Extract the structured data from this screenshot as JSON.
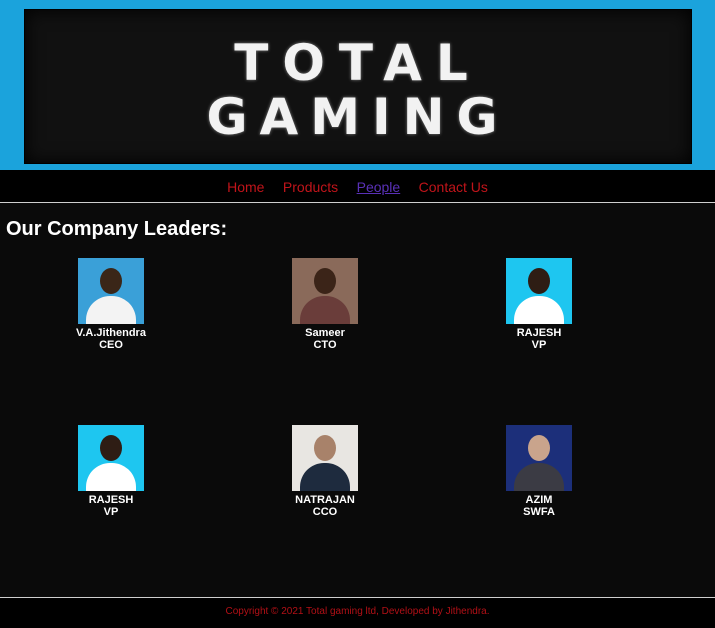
{
  "banner": {
    "line1": "TOTAL",
    "line2": "GAMING"
  },
  "nav": {
    "items": [
      {
        "label": "Home"
      },
      {
        "label": "Products"
      },
      {
        "label": "People"
      },
      {
        "label": "Contact Us"
      }
    ],
    "active": "People"
  },
  "main": {
    "title": "Our Company Leaders:"
  },
  "leaders": [
    {
      "name": "V.A.Jithendra",
      "role": "CEO"
    },
    {
      "name": "Sameer",
      "role": "CTO"
    },
    {
      "name": "RAJESH",
      "role": "VP"
    },
    {
      "name": "RAJESH",
      "role": "VP"
    },
    {
      "name": "NATRAJAN",
      "role": "CCO"
    },
    {
      "name": "AZIM",
      "role": "SWFA"
    }
  ],
  "footer": {
    "text": "Copyright © 2021 Total gaming ltd, Developed by Jithendra."
  },
  "colors": {
    "banner_bg": "#1ba3dc",
    "nav_link": "#c0141a",
    "nav_active": "#5a31b8",
    "footer_text": "#b21016"
  }
}
